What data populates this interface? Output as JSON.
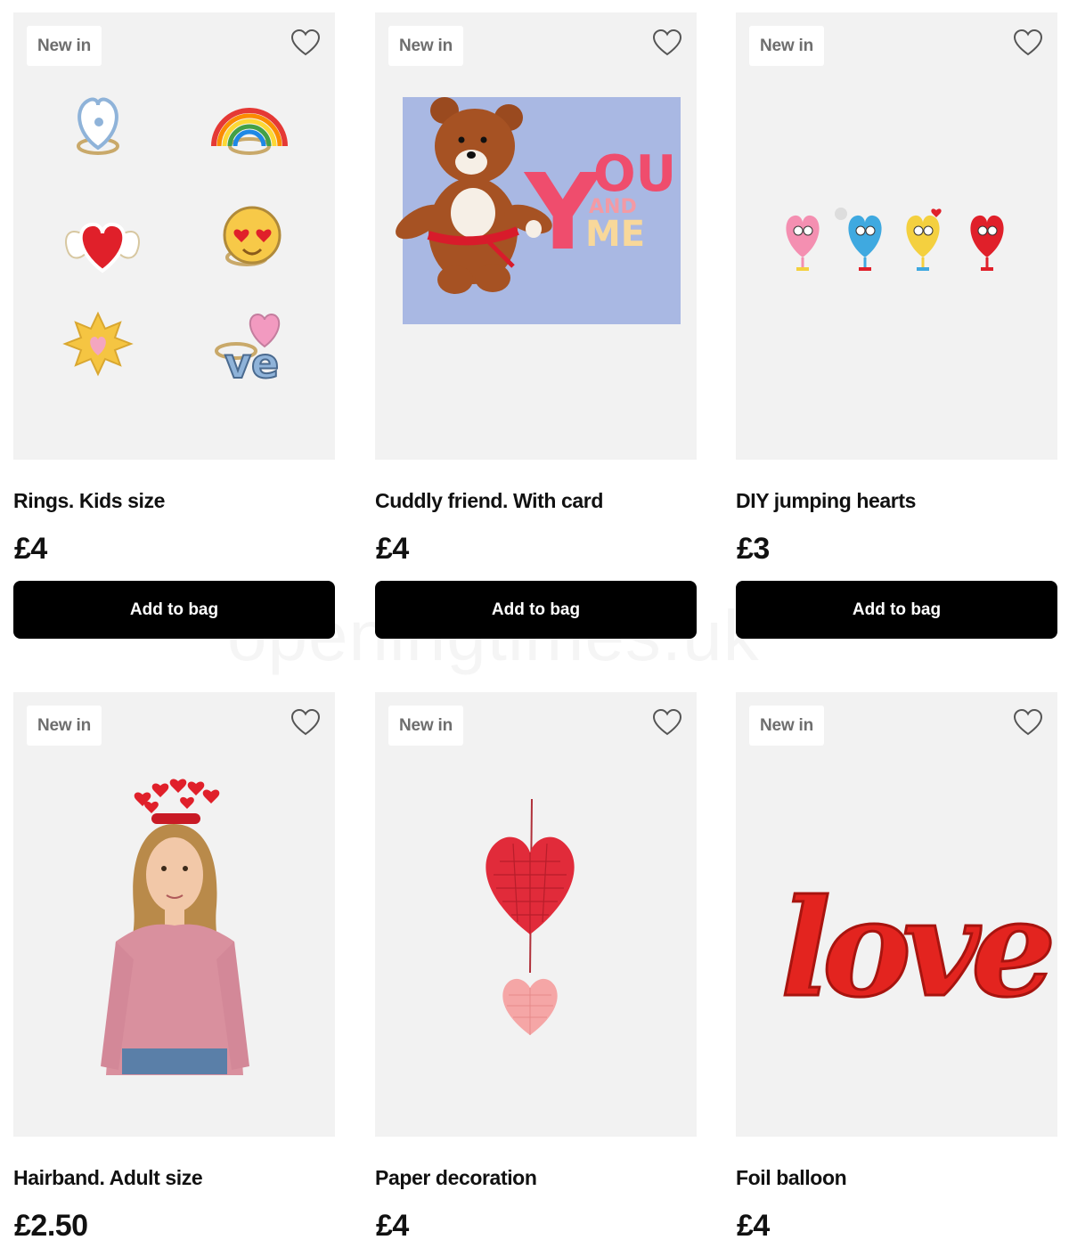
{
  "watermark": "openingtimes.uk",
  "products": [
    {
      "badge": "New in",
      "title": "Rings. Kids size",
      "price": "£4",
      "button": "Add to bag",
      "image": "rings-set"
    },
    {
      "badge": "New in",
      "title": "Cuddly friend. With card",
      "price": "£4",
      "button": "Add to bag",
      "image": "teddy-card",
      "card_text": [
        "YOU",
        "AND",
        "ME"
      ]
    },
    {
      "badge": "New in",
      "title": "DIY jumping hearts",
      "price": "£3",
      "button": "Add to bag",
      "image": "jumping-hearts"
    },
    {
      "badge": "New in",
      "title": "Hairband. Adult size",
      "price": "£2.50",
      "image": "hairband-model"
    },
    {
      "badge": "New in",
      "title": "Paper decoration",
      "price": "£4",
      "image": "honeycomb-hearts"
    },
    {
      "badge": "New in",
      "title": "Foil balloon",
      "price": "£4",
      "image": "love-balloon",
      "balloon_text": "love"
    }
  ],
  "icons": {
    "wishlist": "heart-outline-icon"
  },
  "colors": {
    "button_bg": "#000000",
    "button_text": "#ffffff",
    "media_bg": "#f2f2f2",
    "badge_text": "#6e6e6e",
    "accent_red": "#e0202a"
  }
}
